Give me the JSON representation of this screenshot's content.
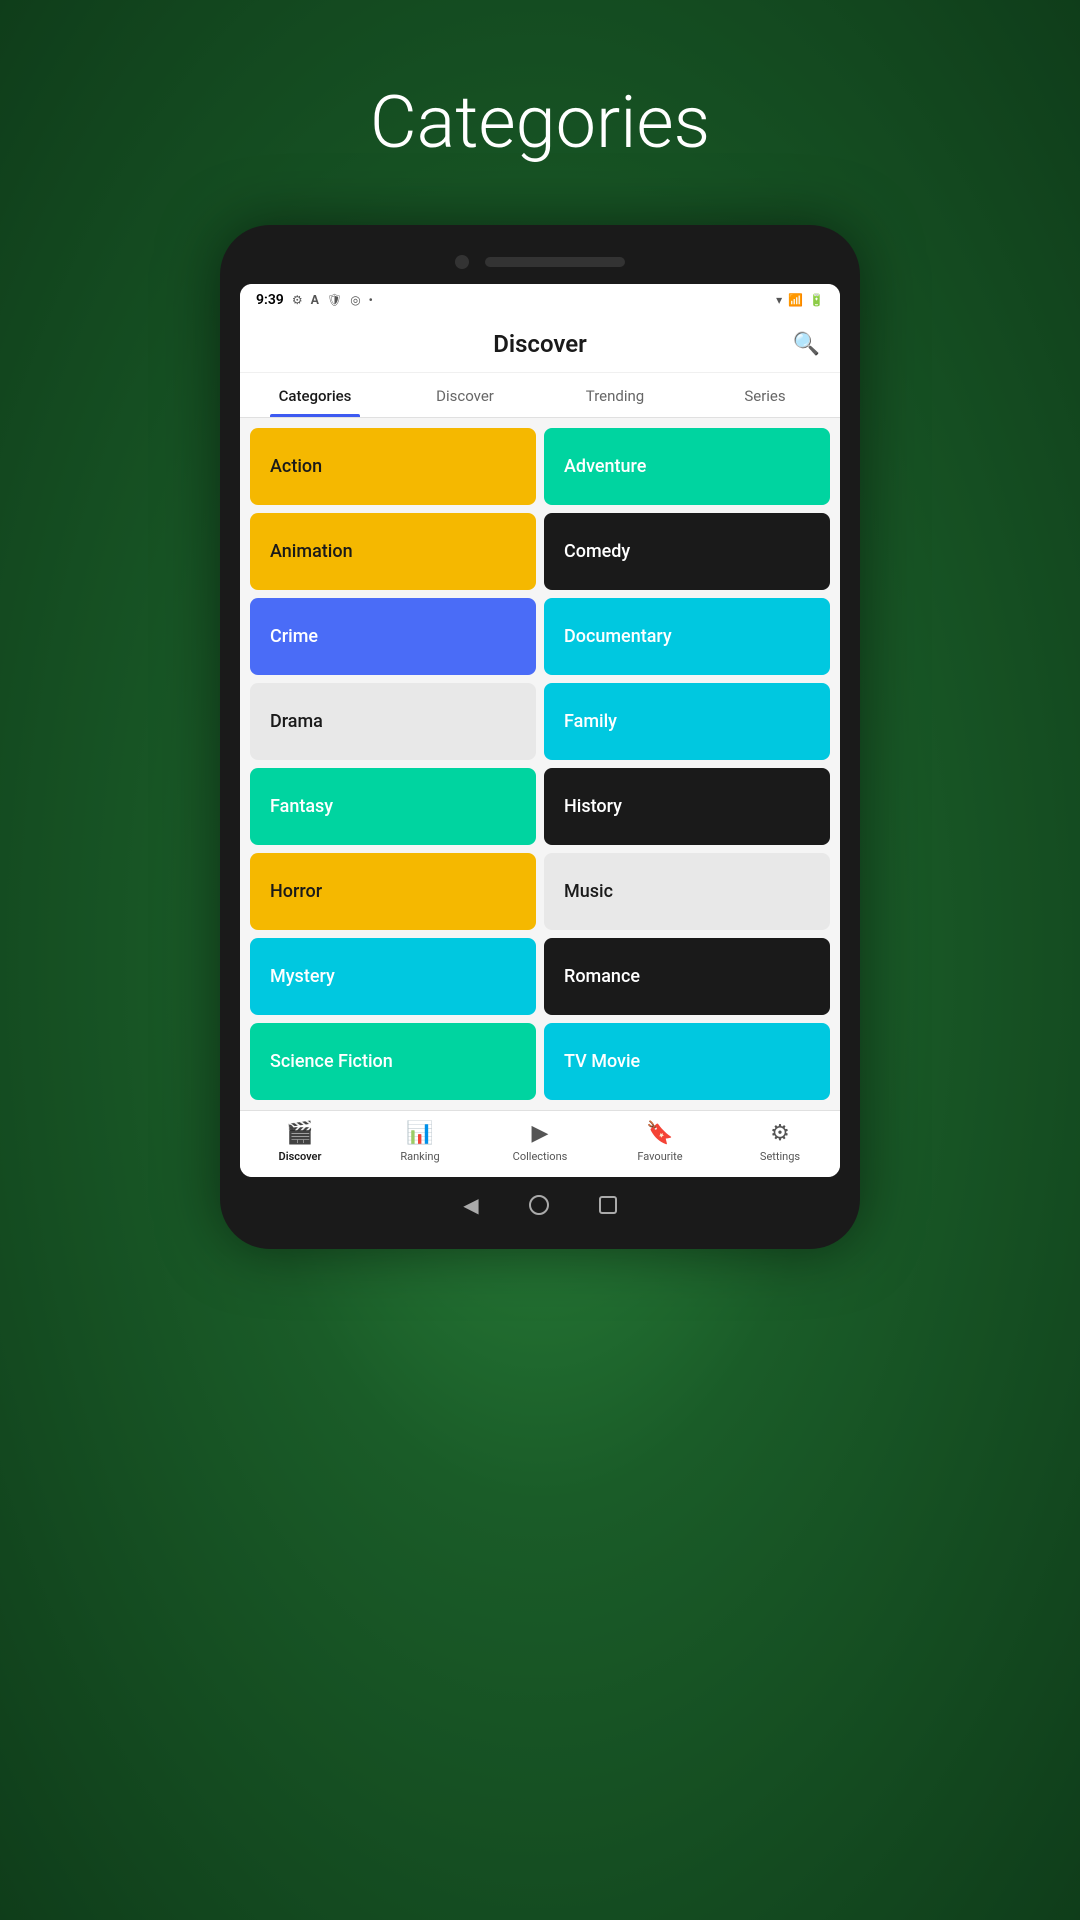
{
  "page": {
    "title": "Categories",
    "background_color": "#1e7a3a"
  },
  "status_bar": {
    "time": "9:39",
    "icons": [
      "gear",
      "A",
      "shield",
      "circle-dot",
      "dot"
    ]
  },
  "app_header": {
    "title": "Discover",
    "search_icon": "🔍"
  },
  "tabs": [
    {
      "label": "Categories",
      "active": true
    },
    {
      "label": "Discover",
      "active": false
    },
    {
      "label": "Trending",
      "active": false
    },
    {
      "label": "Series",
      "active": false
    }
  ],
  "categories": [
    {
      "label": "Action",
      "color_class": "cat-yellow"
    },
    {
      "label": "Adventure",
      "color_class": "cat-teal"
    },
    {
      "label": "Animation",
      "color_class": "cat-yellow"
    },
    {
      "label": "Comedy",
      "color_class": "cat-black"
    },
    {
      "label": "Crime",
      "color_class": "cat-blue"
    },
    {
      "label": "Documentary",
      "color_class": "cat-cyan"
    },
    {
      "label": "Drama",
      "color_class": "cat-light"
    },
    {
      "label": "Family",
      "color_class": "cat-cyan"
    },
    {
      "label": "Fantasy",
      "color_class": "cat-teal"
    },
    {
      "label": "History",
      "color_class": "cat-dark"
    },
    {
      "label": "Horror",
      "color_class": "cat-yellow"
    },
    {
      "label": "Music",
      "color_class": "cat-light"
    },
    {
      "label": "Mystery",
      "color_class": "cat-cyan2"
    },
    {
      "label": "Romance",
      "color_class": "cat-dark"
    },
    {
      "label": "Science Fiction",
      "color_class": "cat-partial-teal"
    },
    {
      "label": "TV Movie",
      "color_class": "cat-partial-teal2"
    }
  ],
  "bottom_nav": [
    {
      "label": "Discover",
      "icon": "🎬",
      "active": true
    },
    {
      "label": "Ranking",
      "icon": "📊",
      "active": false
    },
    {
      "label": "Collections",
      "icon": "▶",
      "active": false
    },
    {
      "label": "Favourite",
      "icon": "🔖",
      "active": false
    },
    {
      "label": "Settings",
      "icon": "⚙",
      "active": false
    }
  ]
}
